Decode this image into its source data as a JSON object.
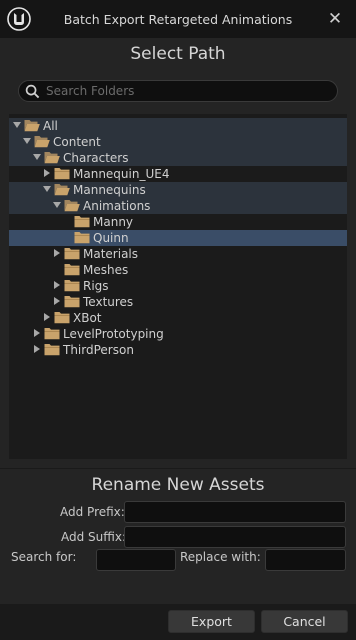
{
  "window": {
    "title": "Batch Export Retargeted Animations",
    "close_glyph": "✕",
    "logo_icon": "unreal-engine-logo"
  },
  "select_path": {
    "heading": "Select Path",
    "search": {
      "placeholder": "Search Folders",
      "value": ""
    },
    "tree": [
      {
        "label": "All",
        "expanded": true,
        "highlight": true
      },
      {
        "label": "Content",
        "expanded": true,
        "highlight": true
      },
      {
        "label": "Characters",
        "expanded": true,
        "highlight": true
      },
      {
        "label": "Mannequin_UE4",
        "expanded": false,
        "highlight": false
      },
      {
        "label": "Mannequins",
        "expanded": true,
        "highlight": true
      },
      {
        "label": "Animations",
        "expanded": true,
        "highlight": true
      },
      {
        "label": "Manny",
        "expanded": null,
        "highlight": false
      },
      {
        "label": "Quinn",
        "expanded": null,
        "highlight": false,
        "selected": true
      },
      {
        "label": "Materials",
        "expanded": false,
        "highlight": false
      },
      {
        "label": "Meshes",
        "expanded": null,
        "highlight": false
      },
      {
        "label": "Rigs",
        "expanded": false,
        "highlight": false
      },
      {
        "label": "Textures",
        "expanded": false,
        "highlight": false
      },
      {
        "label": "XBot",
        "expanded": false,
        "highlight": false
      },
      {
        "label": "LevelPrototyping",
        "expanded": false,
        "highlight": false
      },
      {
        "label": "ThirdPerson",
        "expanded": false,
        "highlight": false
      }
    ]
  },
  "rename": {
    "heading": "Rename New Assets",
    "add_prefix_label": "Add Prefix:",
    "add_prefix_value": "",
    "add_suffix_label": "Add Suffix:",
    "add_suffix_value": "",
    "search_for_label": "Search for:",
    "search_for_value": "",
    "replace_with_label": "Replace with:",
    "replace_with_value": ""
  },
  "footer": {
    "export_label": "Export",
    "cancel_label": "Cancel"
  },
  "colors": {
    "folder": "#c9a36b",
    "selection": "#3a4d67",
    "path_highlight": "#2c333c"
  }
}
